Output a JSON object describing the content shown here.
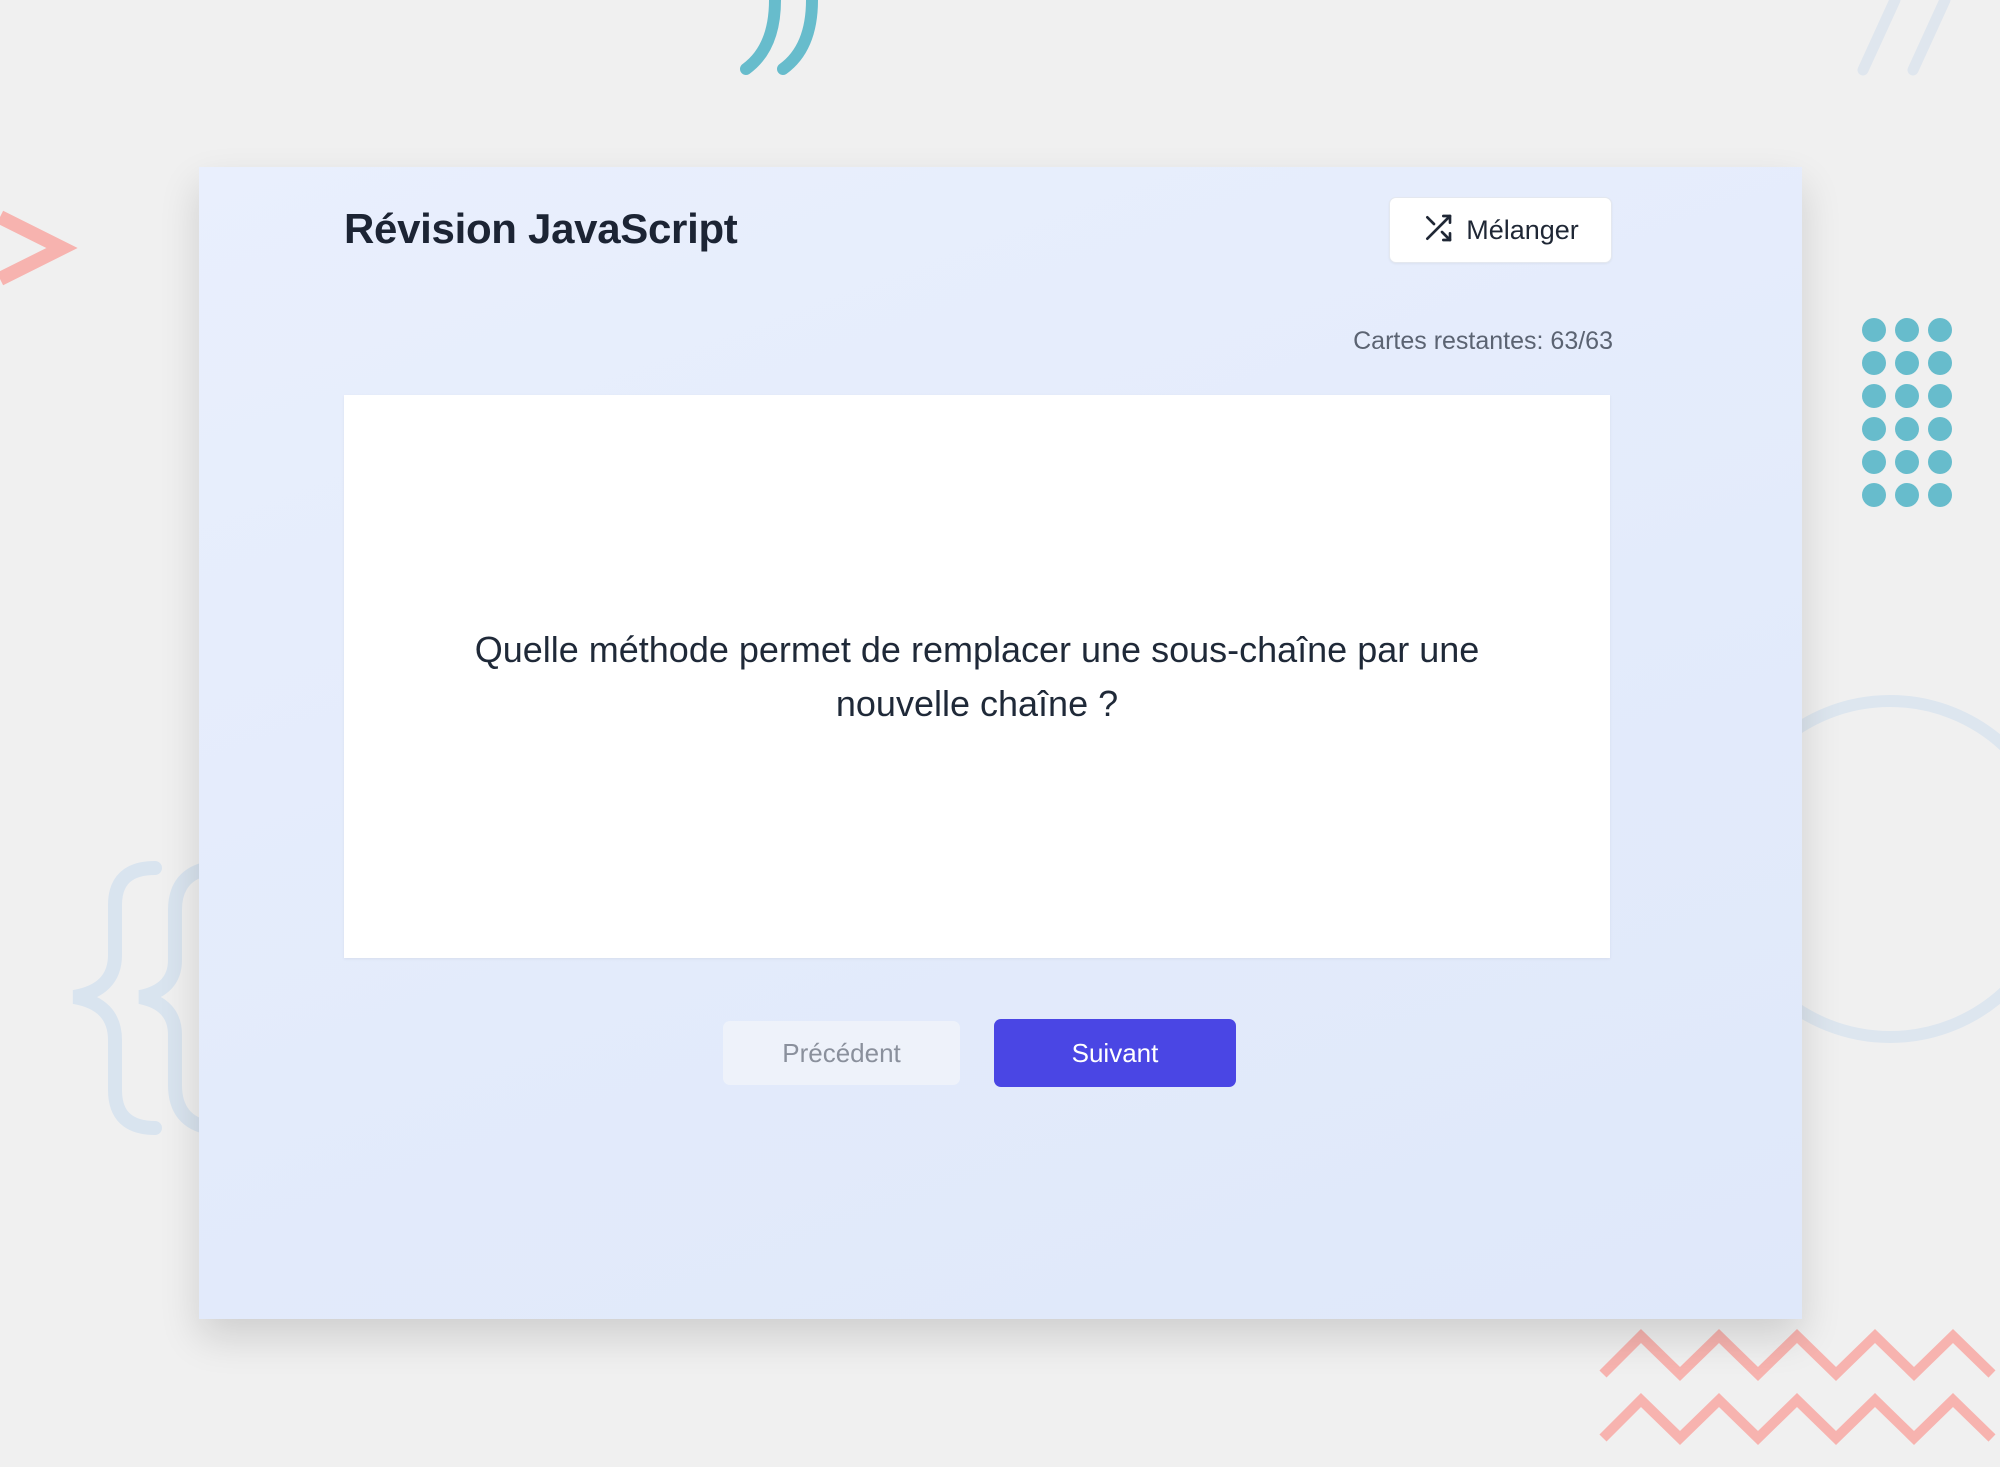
{
  "deck": {
    "title": "Révision JavaScript",
    "remaining": "Cartes restantes: 63/63"
  },
  "toolbar": {
    "shuffle_label": "Mélanger",
    "shuffle_icon": "shuffle-icon"
  },
  "card": {
    "question": "Quelle méthode permet de remplacer une sous-chaîne par une nouvelle chaîne ?"
  },
  "nav": {
    "prev_label": "Précédent",
    "next_label": "Suivant"
  },
  "colors": {
    "primary": "#4a46e4",
    "decor_teal": "#67bccc",
    "decor_coral": "#f7b3af",
    "decor_blue": "#d9e4ef"
  }
}
